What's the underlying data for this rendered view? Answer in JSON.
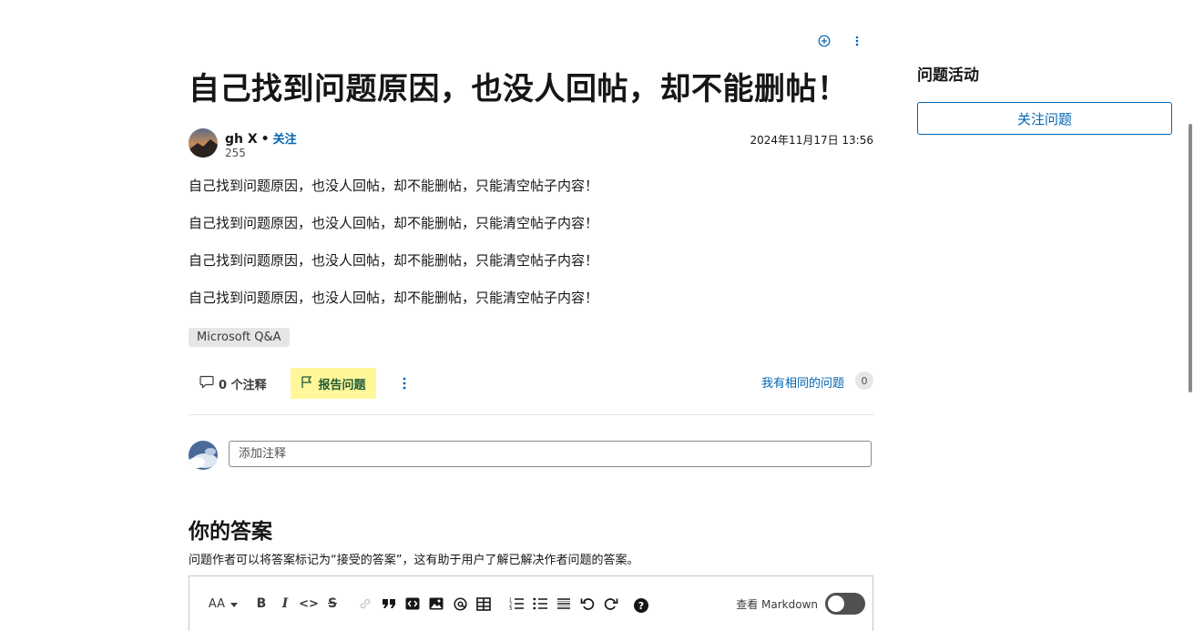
{
  "question": {
    "title": "自己找到问题原因，也没人回帖，却不能删帖！",
    "author": {
      "name": "gh X",
      "separator": "•",
      "follow_label": "关注",
      "reputation": "255"
    },
    "date": "2024年11月17日 13:56",
    "paragraphs": [
      "自己找到问题原因，也没人回帖，却不能删帖，只能清空帖子内容！",
      "自己找到问题原因，也没人回帖，却不能删帖，只能清空帖子内容！",
      "自己找到问题原因，也没人回帖，却不能删帖，只能清空帖子内容！",
      "自己找到问题原因，也没人回帖，却不能删帖，只能清空帖子内容！"
    ],
    "tag": "Microsoft Q&A"
  },
  "actions": {
    "comments_label": "0 个注释",
    "report_label": "报告问题",
    "same_question_label": "我有相同的问题",
    "same_question_count": "0"
  },
  "comment": {
    "placeholder": "添加注释"
  },
  "answer": {
    "heading": "你的答案",
    "description": "问题作者可以将答案标记为“接受的答案”，这有助于用户了解已解决作者问题的答案。"
  },
  "editor": {
    "toolbar": {
      "font_size": "AA",
      "bold": "B",
      "italic": "I",
      "code": "<>",
      "strikethrough": "S",
      "help": "?"
    },
    "markdown_label": "查看 Markdown"
  },
  "sidebar": {
    "heading": "问题活动",
    "follow_question_label": "关注问题"
  },
  "colors": {
    "accent": "#0065b3",
    "report_bg": "#fff799",
    "report_text": "#1e5a35"
  }
}
